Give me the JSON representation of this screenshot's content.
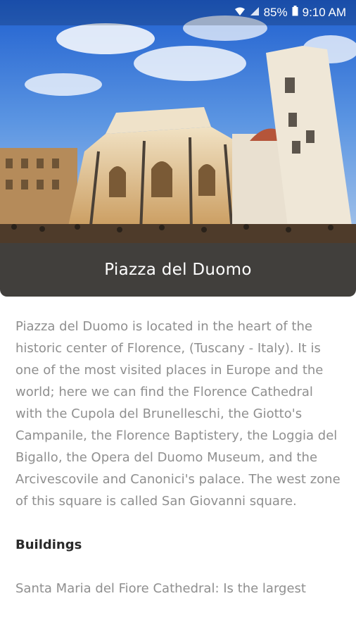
{
  "status_bar": {
    "battery": "85%",
    "time": "9:10 AM",
    "icons": [
      "wifi-icon",
      "signal-icon",
      "battery-icon"
    ]
  },
  "hero": {
    "image": "Florence Baptistery and Cathedral photo"
  },
  "title": "Piazza del Duomo",
  "description": "Piazza del Duomo  is located in the heart of the historic center of Florence, (Tuscany - Italy). It is one of the most visited places in Europe and the world; here we can find the Florence Cathedral with the Cupola del Brunelleschi, the Giotto's Campanile, the Florence Baptistery, the Loggia del Bigallo, the Opera del Duomo Museum, and the Arcivescovile and Canonici's palace. The west zone of this square is called San Giovanni square.",
  "buildings_heading": "Buildings",
  "building_text": "Santa Maria del Fiore Cathedral: Is the largest",
  "colors": {
    "title_bg": "#413f3c",
    "body_text": "#8f8f8f",
    "heading_text": "#2a2a2a"
  }
}
